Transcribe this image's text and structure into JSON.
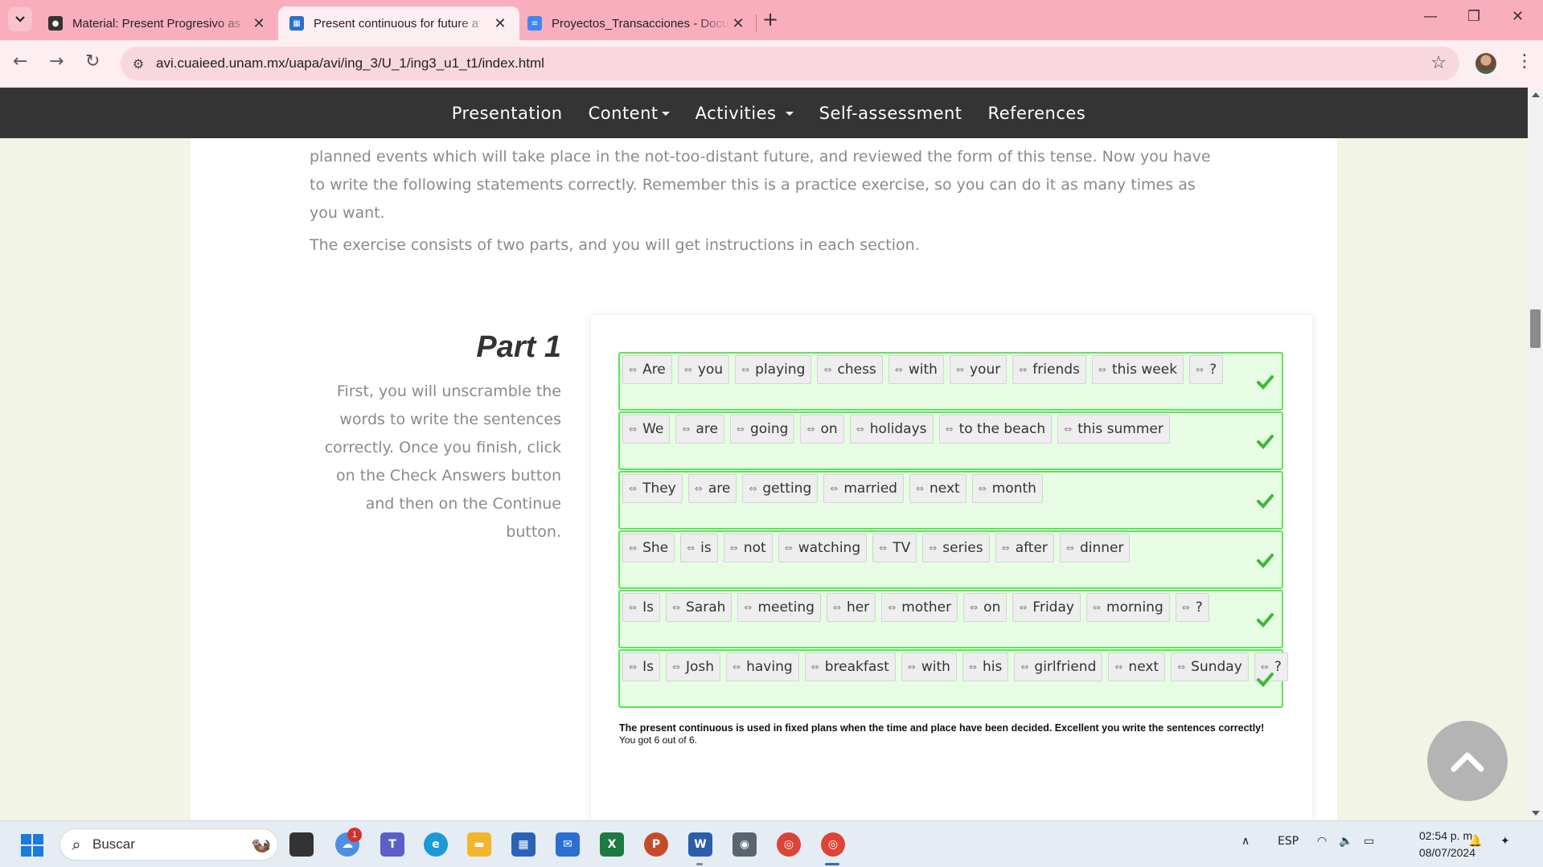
{
  "browser": {
    "tabs": [
      {
        "title": "Material: Present Progresivo as",
        "active": false
      },
      {
        "title": "Present continuous for future a",
        "active": true
      },
      {
        "title": "Proyectos_Transacciones - Docu",
        "active": false
      }
    ],
    "url": "avi.cuaieed.unam.mx/uapa/avi/ing_3/U_1/ing3_u1_t1/index.html"
  },
  "site_nav": {
    "items": [
      "Presentation",
      "Content",
      "Activities",
      "Self-assessment",
      "References"
    ]
  },
  "intro": {
    "paragraph1": "planned events which will take place in the not-too-distant future, and reviewed the form of this tense. Now you have to write the following statements correctly. Remember this is a practice exercise, so you can do it as many times as you want.",
    "paragraph2": "The exercise consists of two parts, and you will get instructions in each section."
  },
  "part": {
    "title": "Part 1",
    "description": "First, you will unscramble the words to write the sentences correctly. Once you finish, click on the Check Answers button and then on the Continue button."
  },
  "sentences": [
    [
      "Are",
      "you",
      "playing",
      "chess",
      "with",
      "your",
      "friends",
      "this week",
      "?"
    ],
    [
      "We",
      "are",
      "going",
      "on",
      "holidays",
      "to the beach",
      "this summer"
    ],
    [
      "They",
      "are",
      "getting",
      "married",
      "next",
      "month"
    ],
    [
      "She",
      "is",
      "not",
      "watching",
      "TV",
      "series",
      "after",
      "dinner"
    ],
    [
      "Is",
      "Sarah",
      "meeting",
      "her",
      "mother",
      "on",
      "Friday",
      "morning",
      "?"
    ],
    [
      "Is",
      "Josh",
      "having",
      "breakfast",
      "with",
      "his",
      "girlfriend",
      "next",
      "Sunday",
      "?"
    ]
  ],
  "sentence_status": [
    "correct",
    "correct",
    "correct",
    "correct",
    "correct",
    "correct"
  ],
  "feedback": {
    "message": "The present continuous is used in fixed plans when the time and place have been decided. Excellent you write the sentences correctly!",
    "score": "You got 6 out of 6."
  },
  "taskbar": {
    "search_placeholder": "Buscar",
    "notification_count": "1",
    "language": "ESP",
    "time": "02:54 p. m.",
    "date": "08/07/2024"
  },
  "colors": {
    "tab_strip": "#f9aebd",
    "toolbar": "#fdeef1",
    "site_nav": "#343434",
    "row_fill": "#e6fde4",
    "row_border": "#5ee35a",
    "check": "#3db83a"
  }
}
